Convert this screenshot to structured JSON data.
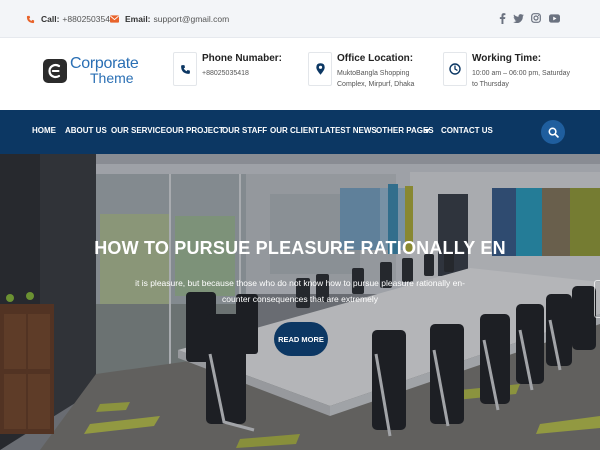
{
  "topbar": {
    "call_label": "Call:",
    "call_value": "+88025035418",
    "email_label": "Email:",
    "email_value": "support@gmail.com",
    "social": [
      "facebook-icon",
      "twitter-icon",
      "instagram-icon",
      "youtube-icon"
    ]
  },
  "logo": {
    "line1": "Corporate",
    "line2": "Theme"
  },
  "info": {
    "phone": {
      "title": "Phone Numaber:",
      "lines": [
        "+88025035418"
      ]
    },
    "office": {
      "title": "Office Location:",
      "lines": [
        "MuktoBangla Shopping",
        "Complex, Mirpurf, Dhaka"
      ]
    },
    "time": {
      "title": "Working Time:",
      "lines": [
        "10:00 am – 06:00 pm, Saturday",
        "to Thursday"
      ]
    }
  },
  "nav": {
    "items": [
      "HOME",
      "ABOUT US",
      "OUR SERVICE",
      "OUR PROJECT",
      "OUR STAFF",
      "OUR CLIENT",
      "LATEST NEWS",
      "OTHER PAGES",
      "CONTACT US"
    ]
  },
  "hero": {
    "title": "HOW TO PURSUE PLEASURE RATIONALLY EN",
    "subtitle": "it is pleasure, but because those who do not know how to pursue pleasure rationally en- counter consequences that are extremely",
    "button": "READ MORE"
  },
  "colors": {
    "accent": "#e8632b",
    "nav_bg": "#0c3763",
    "brand_blue": "#2a6fb4"
  }
}
